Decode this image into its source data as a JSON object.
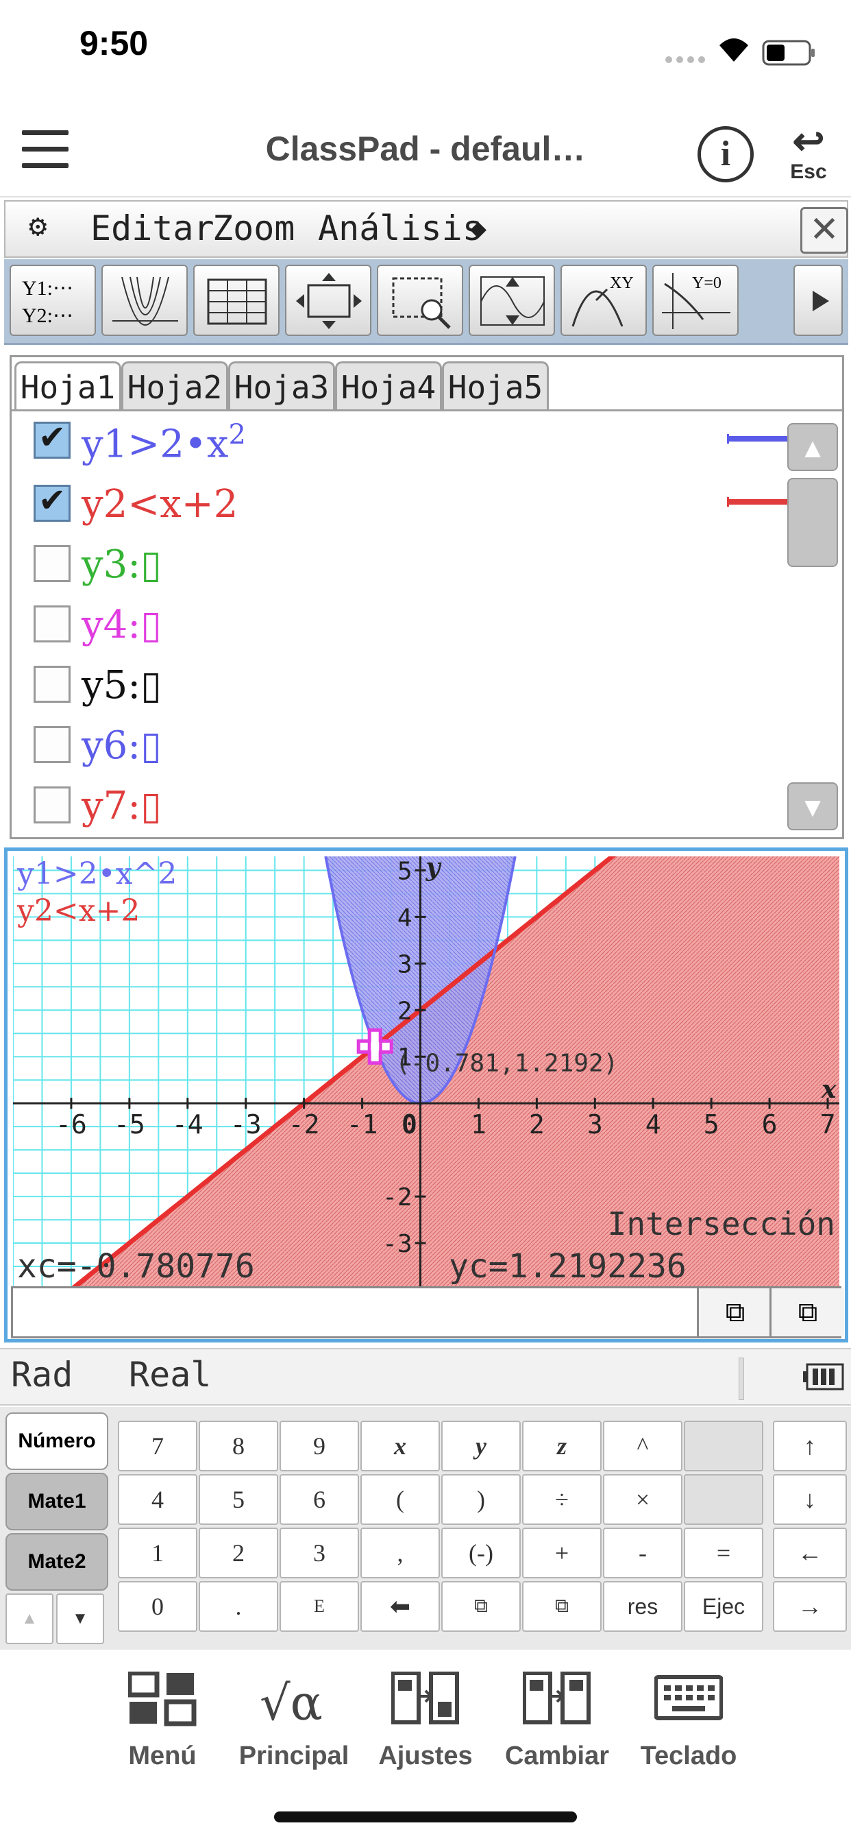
{
  "status": {
    "time": "9:50"
  },
  "header": {
    "title": "ClassPad - defaul…",
    "esc_label": "Esc"
  },
  "menu": {
    "items": [
      "Editar",
      "Zoom",
      "Análisis"
    ]
  },
  "editor": {
    "tabs": [
      "Hoja1",
      "Hoja2",
      "Hoja3",
      "Hoja4",
      "Hoja5"
    ],
    "equations": [
      {
        "label": "y1>2•x",
        "sup": "2",
        "checked": true,
        "color": "#5b5bea"
      },
      {
        "label": "y2<x+2",
        "sup": "",
        "checked": true,
        "color": "#e03c3c"
      },
      {
        "label": "y3:▯",
        "sup": "",
        "checked": false,
        "color": "#34b334"
      },
      {
        "label": "y4:▯",
        "sup": "",
        "checked": false,
        "color": "#e03ce0"
      },
      {
        "label": "y5:▯",
        "sup": "",
        "checked": false,
        "color": "#111111"
      },
      {
        "label": "y6:▯",
        "sup": "",
        "checked": false,
        "color": "#5b5bea"
      },
      {
        "label": "y7:▯",
        "sup": "",
        "checked": false,
        "color": "#e03c3c"
      }
    ]
  },
  "graph": {
    "legend1": "y1>2•x^2",
    "legend2": "y2<x+2",
    "point_label": "(-0.781,1.2192)",
    "mode_label": "Intersección",
    "xc": "xc=-0.780776",
    "yc": "yc=1.2192236",
    "x_ticks": [
      "-6",
      "-5",
      "-4",
      "-3",
      "-2",
      "-1",
      "0",
      "1",
      "2",
      "3",
      "4",
      "5",
      "6",
      "7"
    ],
    "y_ticks": [
      "5",
      "4",
      "3",
      "2",
      "1",
      "-2",
      "-3"
    ],
    "x_axis_label": "x",
    "y_axis_label": "y",
    "xlim": [
      -7,
      7.2
    ],
    "ylim": [
      -4,
      5.3
    ],
    "intersection": {
      "x": -0.780776,
      "y": 1.2192236
    },
    "colors": {
      "parabola": "#6c6cf0",
      "line": "#e83030",
      "grid": "#64e6ec"
    }
  },
  "statusrow": {
    "angle": "Rad",
    "mode": "Real"
  },
  "keypad": {
    "tabs": [
      "Número",
      "Mate1",
      "Mate2"
    ],
    "rows": [
      [
        "7",
        "8",
        "9",
        "x",
        "y",
        "z",
        "^",
        "",
        "↑"
      ],
      [
        "4",
        "5",
        "6",
        "(",
        ")",
        "÷",
        "×",
        "",
        "↓"
      ],
      [
        "1",
        "2",
        "3",
        ",",
        "(-)",
        "+",
        "-",
        "=",
        "←"
      ],
      [
        "0",
        ".",
        "E",
        "⬅",
        "⧉",
        "⧉",
        "res",
        "Ejec",
        "→"
      ]
    ]
  },
  "bottomnav": [
    "Menú",
    "Principal",
    "Ajustes",
    "Cambiar",
    "Teclado"
  ]
}
